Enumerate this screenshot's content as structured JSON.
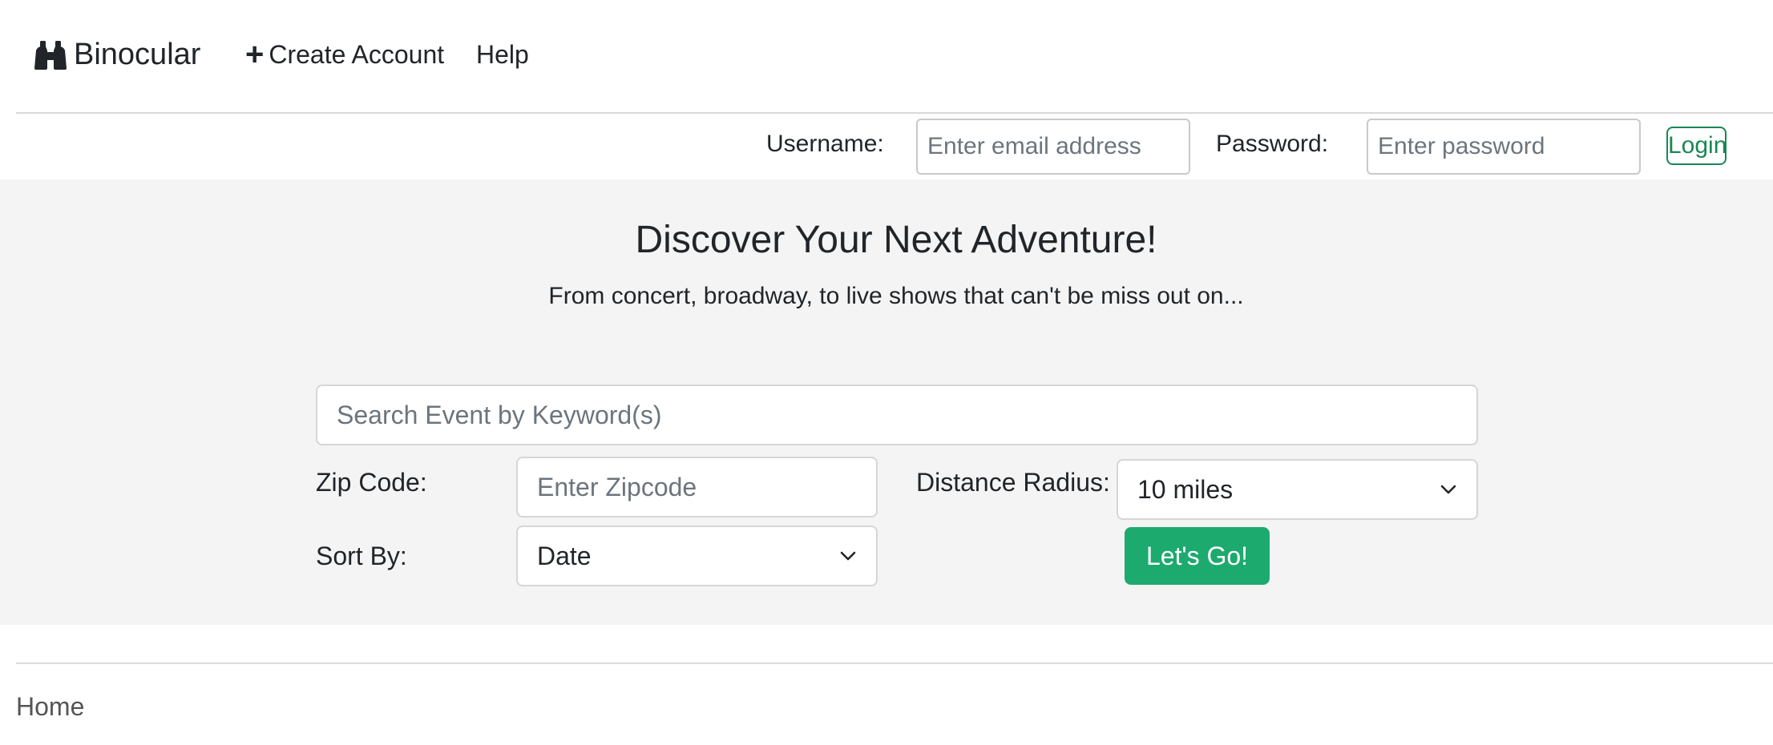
{
  "nav": {
    "brand": "Binocular",
    "brand_icon": "binoculars-icon",
    "create_account": "Create Account",
    "create_icon": "plus-icon",
    "help": "Help"
  },
  "login": {
    "username_label": "Username:",
    "username_placeholder": "Enter email address",
    "username_value": "",
    "password_label": "Password:",
    "password_placeholder": "Enter password",
    "password_value": "",
    "login_button": "Login"
  },
  "hero": {
    "title": "Discover Your Next Adventure!",
    "subtitle": "From concert, broadway, to live shows that can't be miss out on...",
    "search_placeholder": "Search Event by Keyword(s)",
    "search_value": "",
    "zip_label": "Zip Code:",
    "zip_placeholder": "Enter Zipcode",
    "zip_value": "",
    "distance_label": "Distance Radius:",
    "distance_selected": "10 miles",
    "sort_label": "Sort By:",
    "sort_selected": "Date",
    "go_button": "Let's Go!"
  },
  "breadcrumb": {
    "home": "Home"
  },
  "colors": {
    "accent_green": "#1daa6e",
    "outline_green": "#198754",
    "hero_background": "#f4f4f4"
  }
}
